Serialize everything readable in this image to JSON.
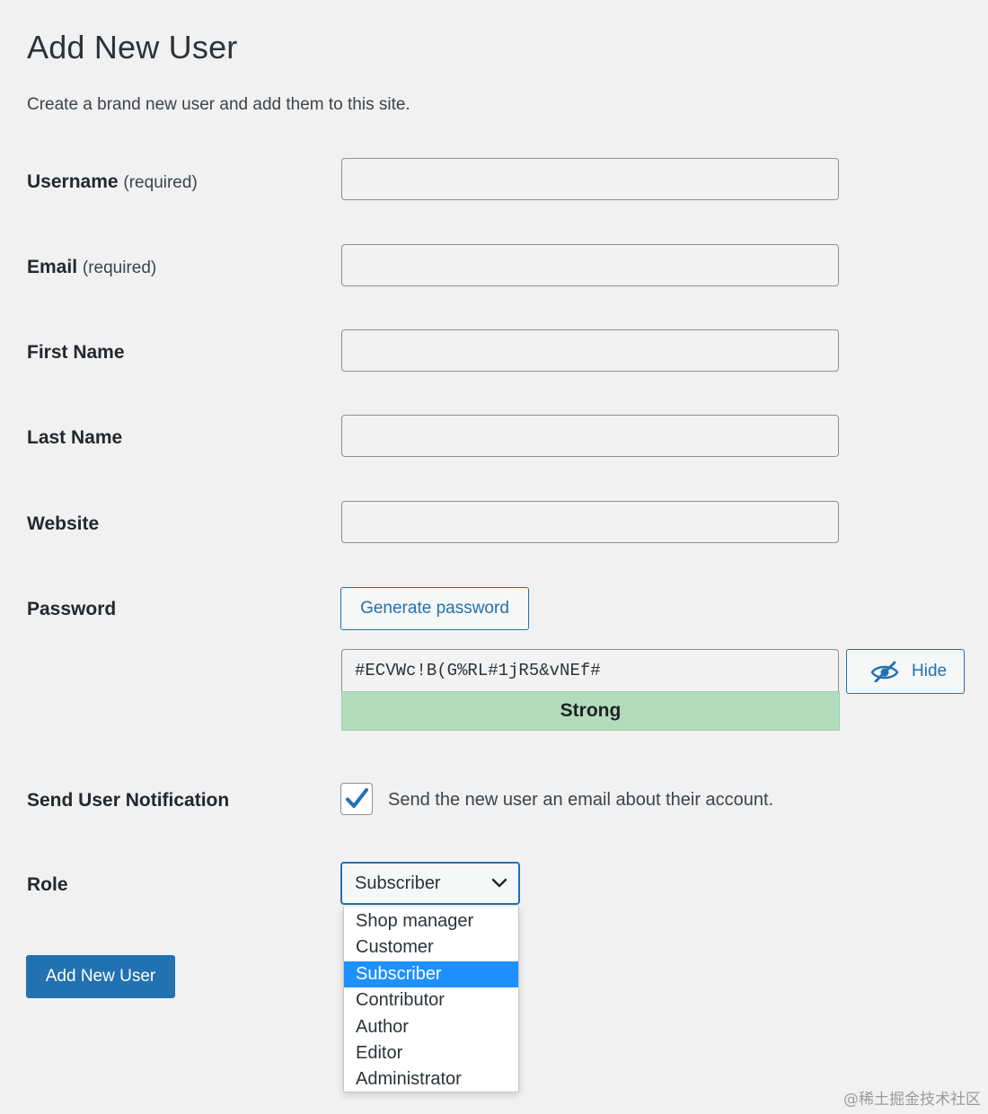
{
  "page": {
    "title": "Add New User",
    "description": "Create a brand new user and add them to this site."
  },
  "fields": {
    "username": {
      "label": "Username",
      "required": "(required)",
      "value": ""
    },
    "email": {
      "label": "Email",
      "required": "(required)",
      "value": ""
    },
    "first_name": {
      "label": "First Name",
      "value": ""
    },
    "last_name": {
      "label": "Last Name",
      "value": ""
    },
    "website": {
      "label": "Website",
      "value": ""
    }
  },
  "password": {
    "label": "Password",
    "generate_label": "Generate password",
    "value": "#ECVWc!B(G%RL#1jR5&vNEf#",
    "hide_label": "Hide",
    "strength": "Strong",
    "strength_color": "#b3dcbd"
  },
  "notification": {
    "label": "Send User Notification",
    "checked": true,
    "checkbox_label": "Send the new user an email about their account."
  },
  "role": {
    "label": "Role",
    "selected": "Subscriber",
    "options": [
      {
        "label": "Shop manager"
      },
      {
        "label": "Customer"
      },
      {
        "label": "Subscriber",
        "selected": true
      },
      {
        "label": "Contributor"
      },
      {
        "label": "Author"
      },
      {
        "label": "Editor"
      },
      {
        "label": "Administrator"
      }
    ]
  },
  "submit": {
    "label": "Add New User"
  },
  "watermark": "@稀土掘金技术社区",
  "colors": {
    "accent": "#2271b1",
    "background": "#f1f1f1",
    "highlight": "#1e90ff",
    "strength_bg": "#b3dcbd"
  }
}
